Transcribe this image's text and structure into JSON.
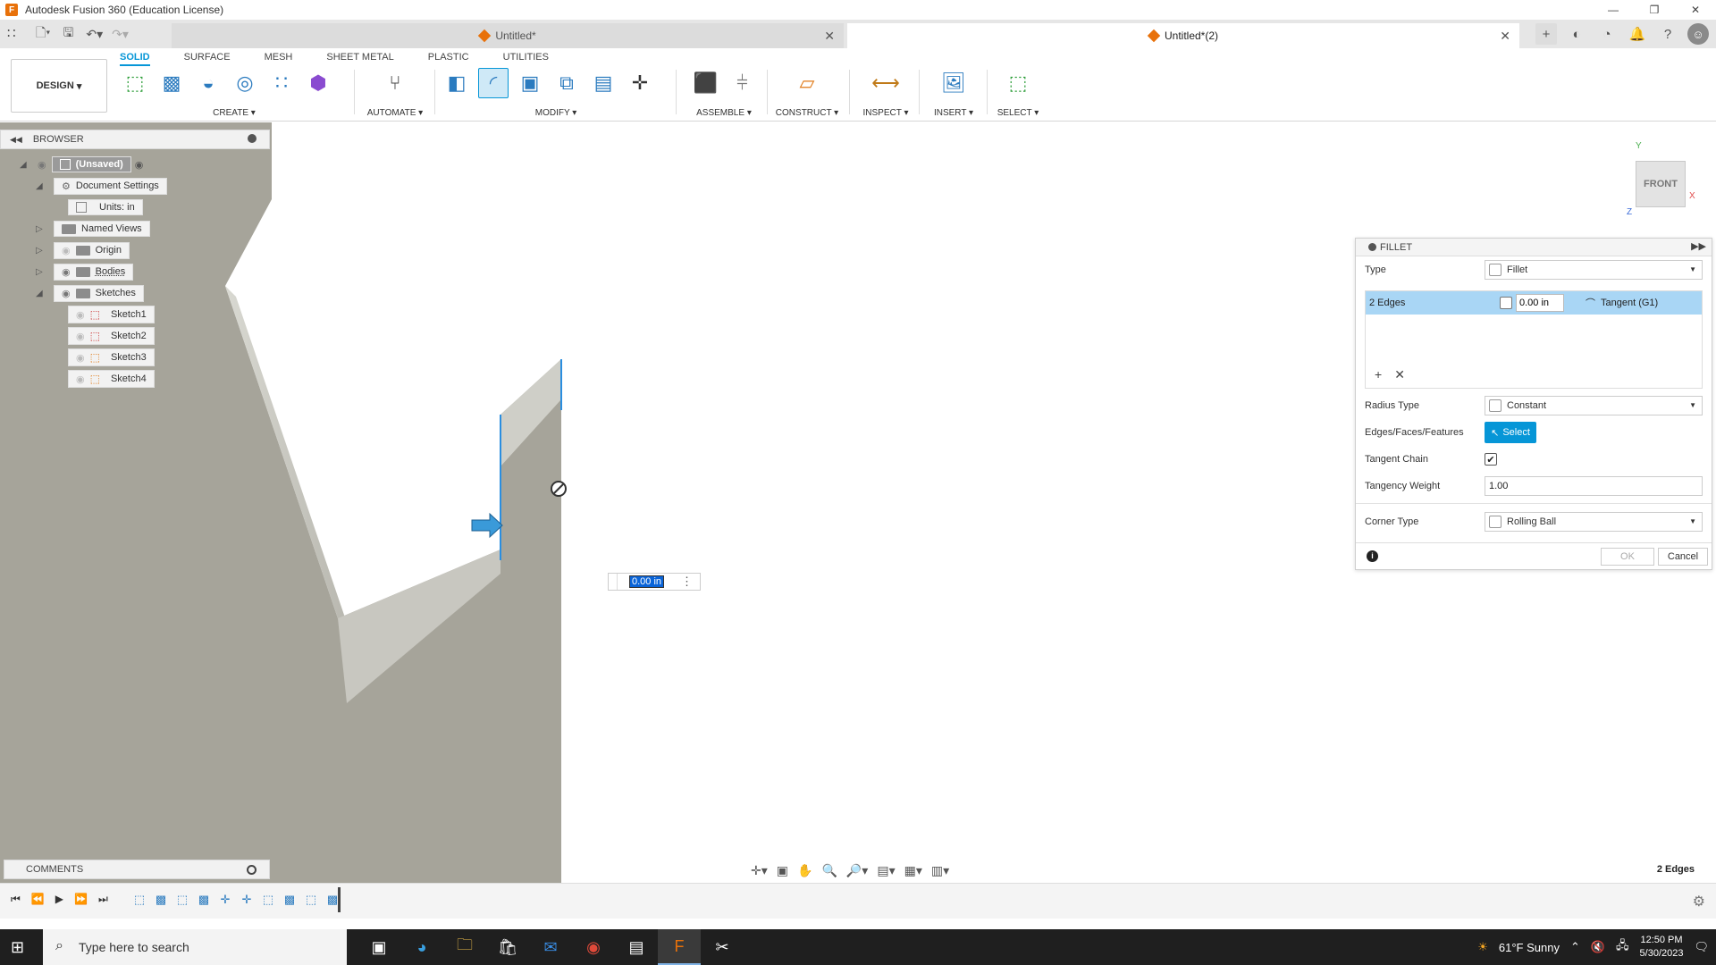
{
  "window": {
    "title": "Autodesk Fusion 360 (Education License)"
  },
  "tabs": [
    {
      "label": "Untitled*",
      "active": false
    },
    {
      "label": "Untitled*(2)",
      "active": true
    }
  ],
  "toolbar": {
    "workspace": "DESIGN",
    "subtabs": [
      "SOLID",
      "SURFACE",
      "MESH",
      "SHEET METAL",
      "PLASTIC",
      "UTILITIES"
    ],
    "groups": {
      "create": "CREATE",
      "automate": "AUTOMATE",
      "modify": "MODIFY",
      "assemble": "ASSEMBLE",
      "construct": "CONSTRUCT",
      "inspect": "INSPECT",
      "insert": "INSERT",
      "select": "SELECT"
    }
  },
  "browser": {
    "title": "BROWSER",
    "items": [
      {
        "label": "(Unsaved)"
      },
      {
        "label": "Document Settings"
      },
      {
        "label": "Units: in"
      },
      {
        "label": "Named Views"
      },
      {
        "label": "Origin"
      },
      {
        "label": "Bodies"
      },
      {
        "label": "Sketches"
      },
      {
        "label": "Sketch1"
      },
      {
        "label": "Sketch2"
      },
      {
        "label": "Sketch3"
      },
      {
        "label": "Sketch4"
      }
    ]
  },
  "comments": {
    "title": "COMMENTS"
  },
  "float_input": {
    "value": "0.00 in"
  },
  "viewcube": {
    "face": "FRONT",
    "y": "Y",
    "x": "X",
    "z": "Z"
  },
  "fillet": {
    "title": "FILLET",
    "type_label": "Type",
    "type_value": "Fillet",
    "edges_label": "2 Edges",
    "radius_value": "0.00 in",
    "continuity": "Tangent (G1)",
    "radius_type_label": "Radius Type",
    "radius_type_value": "Constant",
    "edges_faces_label": "Edges/Faces/Features",
    "select_label": "Select",
    "tangent_chain_label": "Tangent Chain",
    "tangent_chain_checked": true,
    "tangency_weight_label": "Tangency Weight",
    "tangency_weight_value": "1.00",
    "corner_type_label": "Corner Type",
    "corner_type_value": "Rolling Ball",
    "ok_label": "OK",
    "cancel_label": "Cancel"
  },
  "status": {
    "selection": "2 Edges"
  },
  "taskbar": {
    "search_placeholder": "Type here to search",
    "weather": "61°F  Sunny",
    "time": "12:50 PM",
    "date": "5/30/2023"
  },
  "colors": {
    "accent": "#0696d7",
    "selection_row": "#a9d6f5",
    "model_face": "#a6a49a"
  }
}
